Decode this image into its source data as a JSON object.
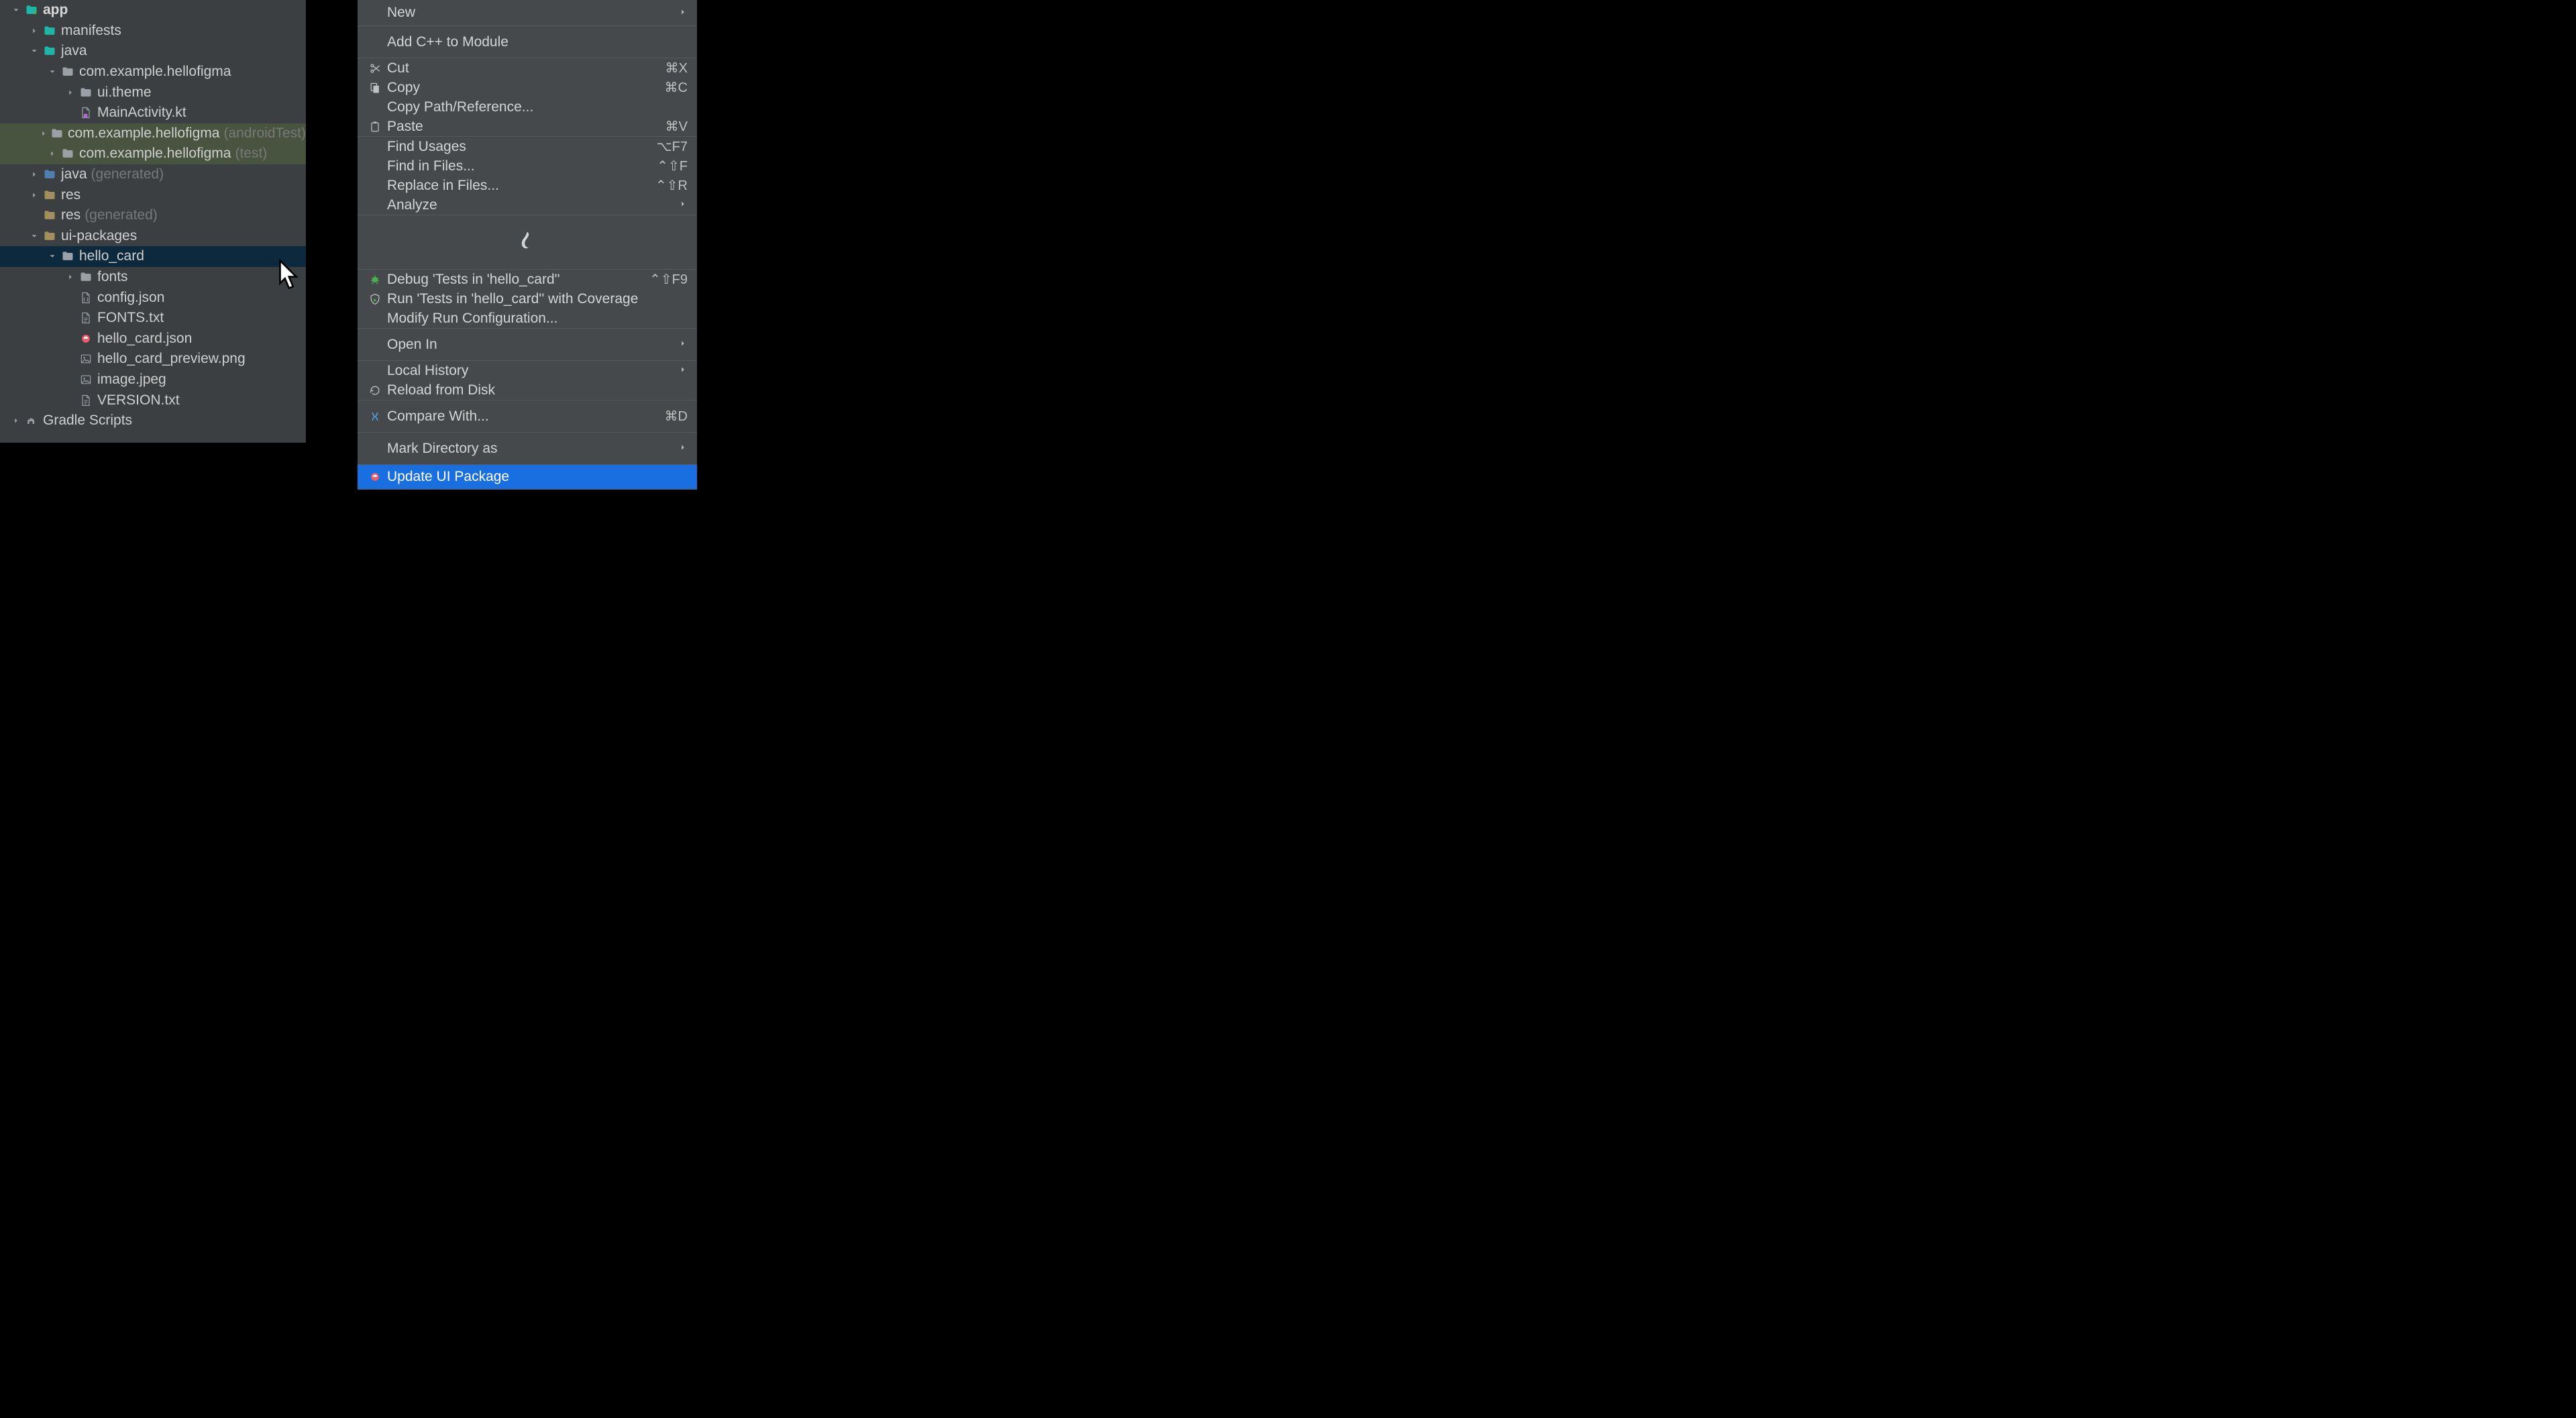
{
  "tree": {
    "app": "app",
    "manifests": "manifests",
    "java": "java",
    "pkg_main": "com.example.hellofigma",
    "ui_theme": "ui.theme",
    "main_activity": "MainActivity.kt",
    "pkg_androidTest": "com.example.hellofigma",
    "pkg_androidTest_suffix": "(androidTest)",
    "pkg_test": "com.example.hellofigma",
    "pkg_test_suffix": "(test)",
    "java_gen": "java",
    "java_gen_suffix": "(generated)",
    "res": "res",
    "res_gen": "res",
    "res_gen_suffix": "(generated)",
    "ui_packages": "ui-packages",
    "hello_card": "hello_card",
    "fonts": "fonts",
    "config_json": "config.json",
    "fonts_txt": "FONTS.txt",
    "hello_card_json": "hello_card.json",
    "hello_card_preview": "hello_card_preview.png",
    "image_jpeg": "image.jpeg",
    "version_txt": "VERSION.txt",
    "gradle_scripts": "Gradle Scripts"
  },
  "ctx": {
    "new": "New",
    "addcpp": "Add C++ to Module",
    "cut": "Cut",
    "cut_s": "⌘X",
    "copy": "Copy",
    "copy_s": "⌘C",
    "copypath": "Copy Path/Reference...",
    "paste": "Paste",
    "paste_s": "⌘V",
    "findusages": "Find Usages",
    "findusages_s": "⌥F7",
    "findinfiles": "Find in Files...",
    "findinfiles_s": "⌃⇧F",
    "replaceinfiles": "Replace in Files...",
    "replaceinfiles_s": "⌃⇧R",
    "analyze": "Analyze",
    "debugtests": "Debug 'Tests in 'hello_card''",
    "debugtests_s": "⌃⇧F9",
    "runcov": "Run 'Tests in 'hello_card'' with Coverage",
    "modrun": "Modify Run Configuration...",
    "openin": "Open In",
    "localhist": "Local History",
    "reload": "Reload from Disk",
    "compare": "Compare With...",
    "compare_s": "⌘D",
    "markdir": "Mark Directory as",
    "updateui": "Update UI Package"
  }
}
